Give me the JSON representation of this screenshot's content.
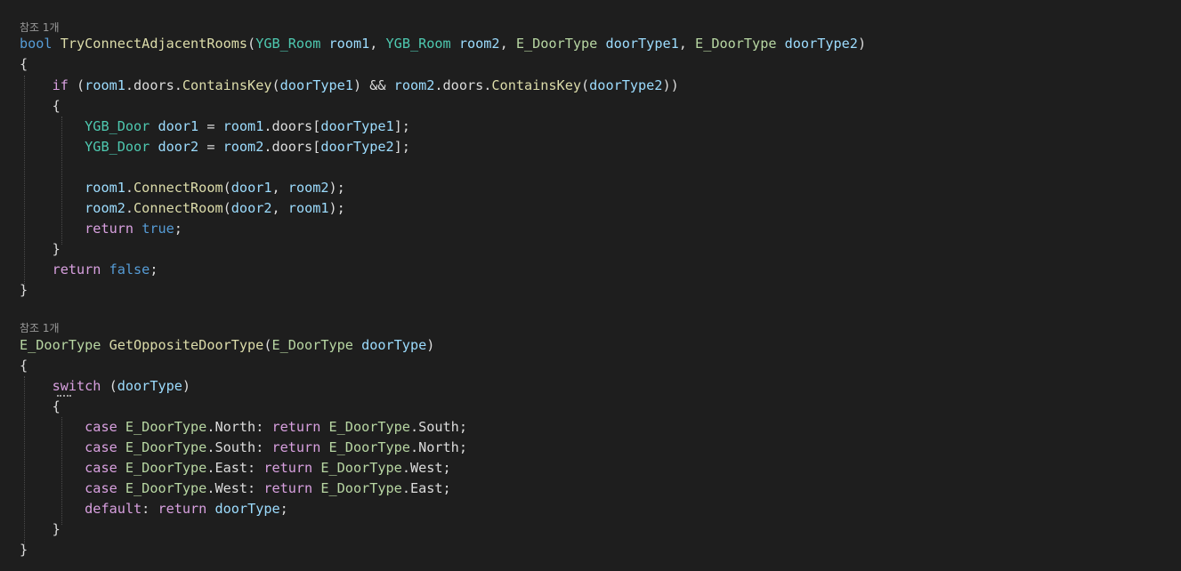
{
  "colors": {
    "background": "#1e1e1e",
    "default": "#dcdcdc",
    "keyword": "#569cd6",
    "control": "#d8a0df",
    "type": "#4ec9b0",
    "enum": "#b8d7a3",
    "method": "#dcdcaa",
    "param": "#9cdcfe",
    "codelens": "#999999"
  },
  "codelens": [
    {
      "text": "참조 1개"
    },
    {
      "text": "참조 1개"
    }
  ],
  "lines": [
    [
      {
        "t": "bool",
        "c": "keyword"
      },
      {
        "t": " "
      },
      {
        "t": "TryConnectAdjacentRooms",
        "c": "method"
      },
      {
        "t": "("
      },
      {
        "t": "YGB_Room",
        "c": "type"
      },
      {
        "t": " "
      },
      {
        "t": "room1",
        "c": "param"
      },
      {
        "t": ", "
      },
      {
        "t": "YGB_Room",
        "c": "type"
      },
      {
        "t": " "
      },
      {
        "t": "room2",
        "c": "param"
      },
      {
        "t": ", "
      },
      {
        "t": "E_DoorType",
        "c": "enum"
      },
      {
        "t": " "
      },
      {
        "t": "doorType1",
        "c": "param"
      },
      {
        "t": ", "
      },
      {
        "t": "E_DoorType",
        "c": "enum"
      },
      {
        "t": " "
      },
      {
        "t": "doorType2",
        "c": "param"
      },
      {
        "t": ")"
      }
    ],
    [
      {
        "t": "{"
      }
    ],
    [
      {
        "t": "    "
      },
      {
        "t": "if",
        "c": "control"
      },
      {
        "t": " ("
      },
      {
        "t": "room1",
        "c": "param"
      },
      {
        "t": ".doors."
      },
      {
        "t": "ContainsKey",
        "c": "method"
      },
      {
        "t": "("
      },
      {
        "t": "doorType1",
        "c": "param"
      },
      {
        "t": ") && "
      },
      {
        "t": "room2",
        "c": "param"
      },
      {
        "t": ".doors."
      },
      {
        "t": "ContainsKey",
        "c": "method"
      },
      {
        "t": "("
      },
      {
        "t": "doorType2",
        "c": "param"
      },
      {
        "t": "))"
      }
    ],
    [
      {
        "t": "    {"
      }
    ],
    [
      {
        "t": "        "
      },
      {
        "t": "YGB_Door",
        "c": "type"
      },
      {
        "t": " "
      },
      {
        "t": "door1",
        "c": "param"
      },
      {
        "t": " = "
      },
      {
        "t": "room1",
        "c": "param"
      },
      {
        "t": ".doors["
      },
      {
        "t": "doorType1",
        "c": "param"
      },
      {
        "t": "];"
      }
    ],
    [
      {
        "t": "        "
      },
      {
        "t": "YGB_Door",
        "c": "type"
      },
      {
        "t": " "
      },
      {
        "t": "door2",
        "c": "param"
      },
      {
        "t": " = "
      },
      {
        "t": "room2",
        "c": "param"
      },
      {
        "t": ".doors["
      },
      {
        "t": "doorType2",
        "c": "param"
      },
      {
        "t": "];"
      }
    ],
    [
      {
        "t": ""
      }
    ],
    [
      {
        "t": "        "
      },
      {
        "t": "room1",
        "c": "param"
      },
      {
        "t": "."
      },
      {
        "t": "ConnectRoom",
        "c": "method"
      },
      {
        "t": "("
      },
      {
        "t": "door1",
        "c": "param"
      },
      {
        "t": ", "
      },
      {
        "t": "room2",
        "c": "param"
      },
      {
        "t": ");"
      }
    ],
    [
      {
        "t": "        "
      },
      {
        "t": "room2",
        "c": "param"
      },
      {
        "t": "."
      },
      {
        "t": "ConnectRoom",
        "c": "method"
      },
      {
        "t": "("
      },
      {
        "t": "door2",
        "c": "param"
      },
      {
        "t": ", "
      },
      {
        "t": "room1",
        "c": "param"
      },
      {
        "t": ");"
      }
    ],
    [
      {
        "t": "        "
      },
      {
        "t": "return",
        "c": "control"
      },
      {
        "t": " "
      },
      {
        "t": "true",
        "c": "keyword"
      },
      {
        "t": ";"
      }
    ],
    [
      {
        "t": "    }"
      }
    ],
    [
      {
        "t": "    "
      },
      {
        "t": "return",
        "c": "control"
      },
      {
        "t": " "
      },
      {
        "t": "false",
        "c": "keyword"
      },
      {
        "t": ";"
      }
    ],
    [
      {
        "t": "}"
      }
    ],
    [
      {
        "t": ""
      }
    ],
    [
      {
        "t": "E_DoorType",
        "c": "enum"
      },
      {
        "t": " "
      },
      {
        "t": "GetOppositeDoorType",
        "c": "method"
      },
      {
        "t": "("
      },
      {
        "t": "E_DoorType",
        "c": "enum"
      },
      {
        "t": " "
      },
      {
        "t": "doorType",
        "c": "param"
      },
      {
        "t": ")"
      }
    ],
    [
      {
        "t": "{"
      }
    ],
    [
      {
        "t": "    "
      },
      {
        "t": "switch",
        "c": "control"
      },
      {
        "t": " ("
      },
      {
        "t": "doorType",
        "c": "param"
      },
      {
        "t": ")"
      }
    ],
    [
      {
        "t": "    {"
      }
    ],
    [
      {
        "t": "        "
      },
      {
        "t": "case",
        "c": "control"
      },
      {
        "t": " "
      },
      {
        "t": "E_DoorType",
        "c": "enum"
      },
      {
        "t": ".North: "
      },
      {
        "t": "return",
        "c": "control"
      },
      {
        "t": " "
      },
      {
        "t": "E_DoorType",
        "c": "enum"
      },
      {
        "t": ".South;"
      }
    ],
    [
      {
        "t": "        "
      },
      {
        "t": "case",
        "c": "control"
      },
      {
        "t": " "
      },
      {
        "t": "E_DoorType",
        "c": "enum"
      },
      {
        "t": ".South: "
      },
      {
        "t": "return",
        "c": "control"
      },
      {
        "t": " "
      },
      {
        "t": "E_DoorType",
        "c": "enum"
      },
      {
        "t": ".North;"
      }
    ],
    [
      {
        "t": "        "
      },
      {
        "t": "case",
        "c": "control"
      },
      {
        "t": " "
      },
      {
        "t": "E_DoorType",
        "c": "enum"
      },
      {
        "t": ".East: "
      },
      {
        "t": "return",
        "c": "control"
      },
      {
        "t": " "
      },
      {
        "t": "E_DoorType",
        "c": "enum"
      },
      {
        "t": ".West;"
      }
    ],
    [
      {
        "t": "        "
      },
      {
        "t": "case",
        "c": "control"
      },
      {
        "t": " "
      },
      {
        "t": "E_DoorType",
        "c": "enum"
      },
      {
        "t": ".West: "
      },
      {
        "t": "return",
        "c": "control"
      },
      {
        "t": " "
      },
      {
        "t": "E_DoorType",
        "c": "enum"
      },
      {
        "t": ".East;"
      }
    ],
    [
      {
        "t": "        "
      },
      {
        "t": "default",
        "c": "control"
      },
      {
        "t": ": "
      },
      {
        "t": "return",
        "c": "control"
      },
      {
        "t": " "
      },
      {
        "t": "doorType",
        "c": "param"
      },
      {
        "t": ";"
      }
    ],
    [
      {
        "t": "    }"
      }
    ],
    [
      {
        "t": "}"
      }
    ]
  ]
}
